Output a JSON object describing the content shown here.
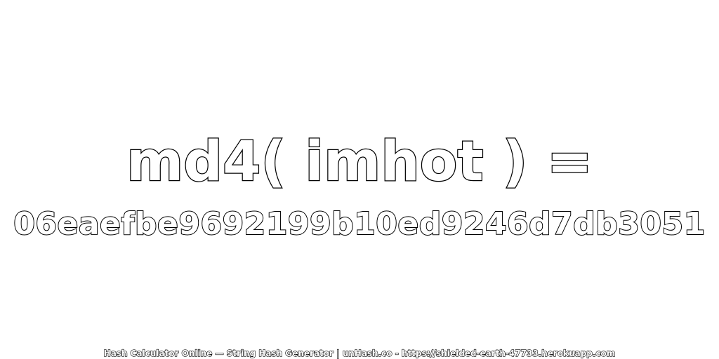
{
  "expression": "md4( imhot ) =",
  "hash": "06eaefbe9692199b10ed9246d7db3051",
  "footer": "Hash Calculator Online — String Hash Generator | unHash.co - https://shielded-earth-47733.herokuapp.com",
  "colors": {
    "background": "#ffffff",
    "text_fill": "#ffffff",
    "text_outline": "#000000"
  }
}
